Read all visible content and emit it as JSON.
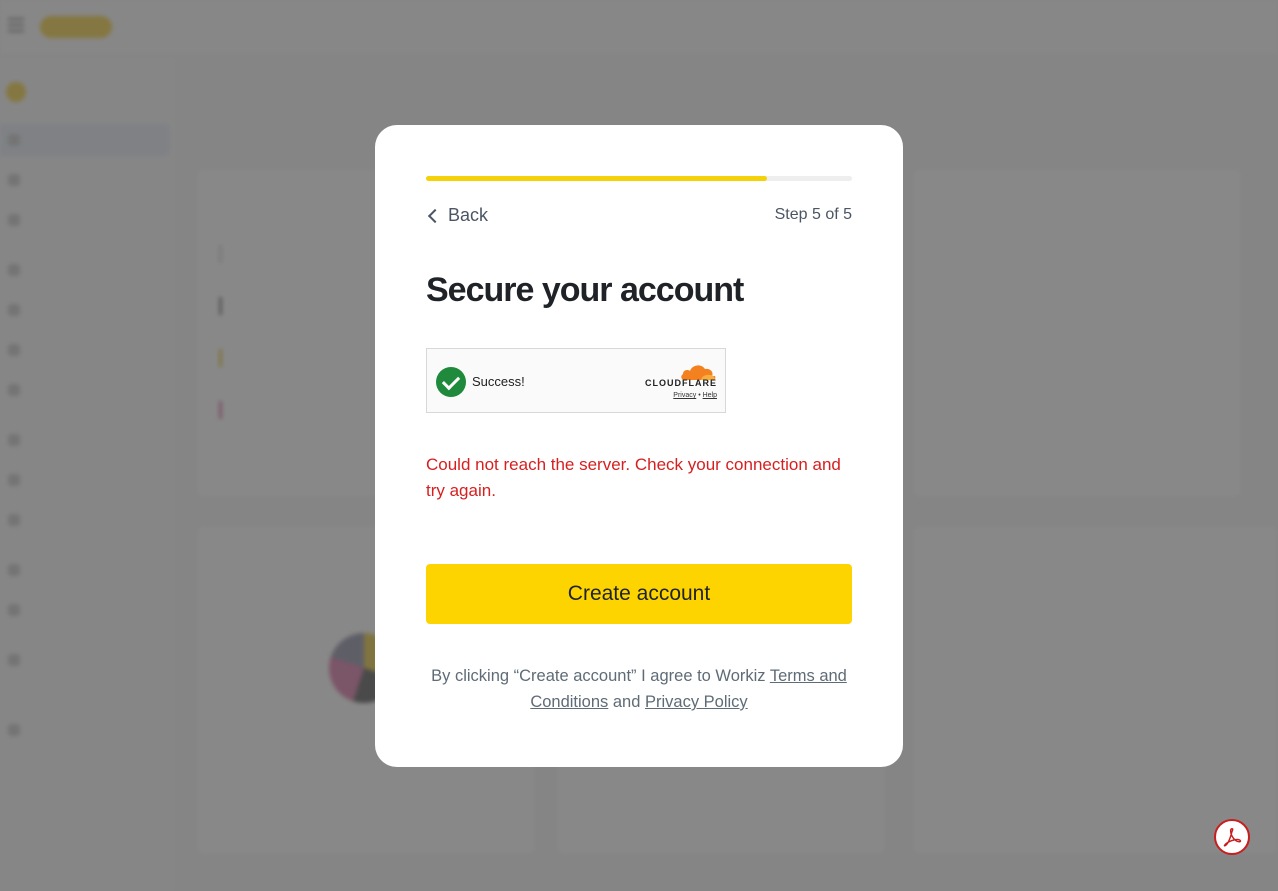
{
  "modal": {
    "progress_fraction": 0.8,
    "back_label": "Back",
    "step_label": "Step 5 of 5",
    "title": "Secure your account",
    "captcha": {
      "status_text": "Success!",
      "provider": "CLOUDFLARE",
      "privacy_link": "Privacy",
      "separator": "•",
      "help_link": "Help"
    },
    "error_message": "Could not reach the server. Check your connection and try again.",
    "submit_label": "Create account",
    "legal": {
      "prefix": "By clicking “Create account” I agree to Workiz ",
      "terms_link": "Terms and Conditions",
      "middle": " and ",
      "privacy_link": "Privacy Policy"
    }
  },
  "colors": {
    "accent_yellow": "#fed400",
    "progress_yellow": "#f5d10a",
    "error_red": "#d62020",
    "captcha_success_green": "#1f8a3b",
    "overlay": "rgba(90,90,90,0.72)"
  },
  "icons": {
    "back": "chevron-left-icon",
    "captcha": "check-circle-icon",
    "cloudflare": "cloudflare-cloud-icon",
    "pdf": "adobe-pdf-icon"
  }
}
